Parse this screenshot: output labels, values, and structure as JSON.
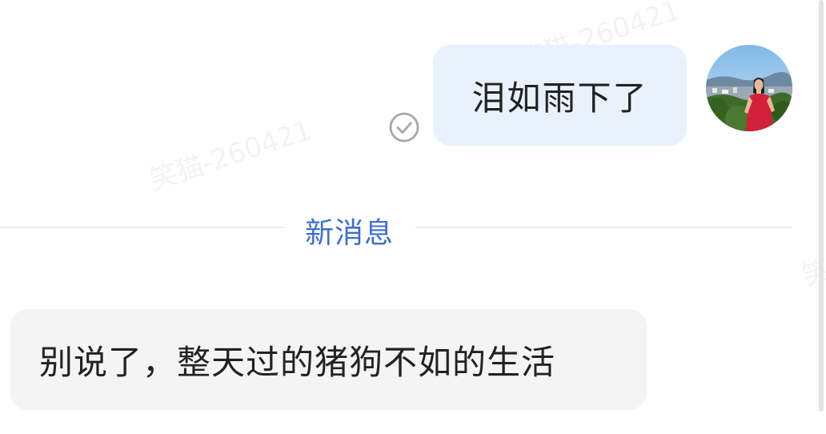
{
  "watermark": {
    "text": "笑猫-260421"
  },
  "messages": {
    "outgoing": {
      "text": "泪如雨下了",
      "status_icon": "read-check-icon",
      "avatar": "user-avatar-woman-red-dress"
    },
    "divider": {
      "label": "新消息"
    },
    "incoming": {
      "text": "别说了，整天过的猪狗不如的生活"
    }
  },
  "colors": {
    "outgoing_bubble": "#e9f1fd",
    "incoming_bubble": "#f4f4f4",
    "divider_label": "#3d6fd0",
    "message_text": "#222222"
  }
}
